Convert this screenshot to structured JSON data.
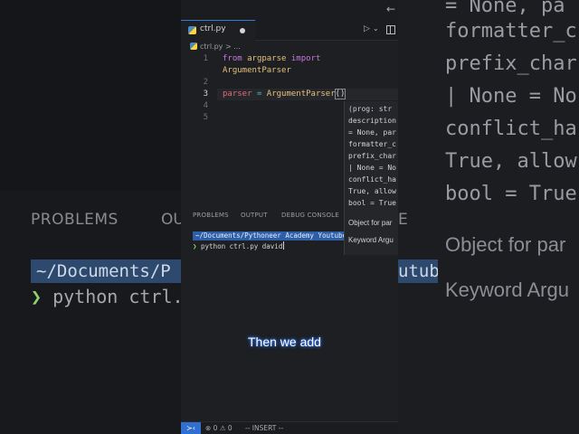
{
  "editor": {
    "tab": {
      "filename": "ctrl.py"
    },
    "breadcrumb": {
      "file": "ctrl.py",
      "sep": ">",
      "rest": "..."
    },
    "code": {
      "line_numbers": [
        "1",
        "2",
        "3",
        "4",
        "5"
      ],
      "line1": {
        "kw1": "from",
        "module": "argparse",
        "kw2": "import"
      },
      "line1b": {
        "name": "ArgumentParser"
      },
      "line3": {
        "var": "parser",
        "op": "=",
        "call": "ArgumentParser",
        "parens": "()"
      }
    }
  },
  "popup": {
    "sig_lines": [
      "(prog: str",
      "description",
      "= None, par",
      "formatter_c",
      "prefix_char",
      "| None = No",
      "conflict_ha",
      "True, allow",
      "bool = True"
    ],
    "doc1": "Object for par",
    "doc2": "Keyword Argu"
  },
  "panel": {
    "tabs": [
      "PROBLEMS",
      "OUTPUT",
      "DEBUG CONSOLE"
    ],
    "terminal": {
      "path": "~/Documents/Pythoneer Academy Youtube",
      "prompt": "❯",
      "command": "python ctrl.py david"
    }
  },
  "caption": "Then we add",
  "statusbar": {
    "remote": "≻‹",
    "errors": "⊗ 0 ⚠ 0",
    "mode": "-- INSERT --"
  },
  "background": {
    "problems": "PROBLEMS",
    "ou": "OU",
    "e": "E",
    "path": "~/Documents/P",
    "ytb": "utube",
    "cmd_prompt": "❯",
    "cmd": "python ctrl.",
    "right_lines": [
      "= None, pa",
      "formatter_c",
      "prefix_char",
      "| None = No",
      "conflict_ha",
      "True, allow",
      "bool = True"
    ],
    "right_doc1": "Object for par",
    "right_doc2": "Keyword Argu"
  }
}
